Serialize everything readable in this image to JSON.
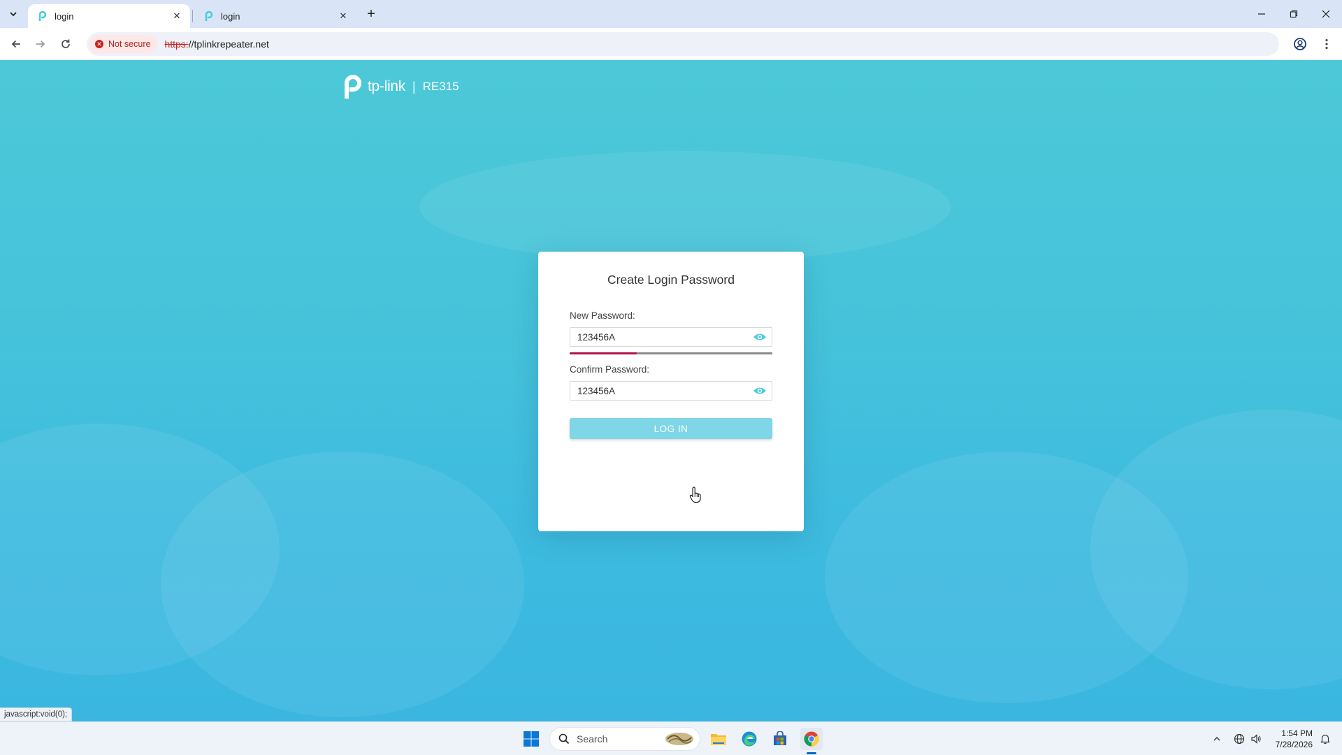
{
  "browser": {
    "tabs": [
      {
        "title": "login",
        "active": true
      },
      {
        "title": "login",
        "active": false
      }
    ],
    "security_chip": "Not secure",
    "url_scheme": "https:",
    "url_rest": "//tplinkrepeater.net",
    "status_bar": "javascript:void(0);"
  },
  "brand": {
    "logo_text": "tp-link",
    "separator": "|",
    "model": "RE315"
  },
  "form": {
    "title": "Create Login Password",
    "new_password_label": "New Password:",
    "new_password_value": "123456A",
    "strength_level": 0.33,
    "confirm_password_label": "Confirm Password:",
    "confirm_password_value": "123456A",
    "login_button": "LOG IN"
  },
  "taskbar": {
    "search_placeholder": "Search",
    "time": "1:54 PM",
    "date": "7/28/2026"
  },
  "colors": {
    "accent": "#4acbe0",
    "button": "#7fd6e6",
    "strength_fill": "#b0144a"
  }
}
